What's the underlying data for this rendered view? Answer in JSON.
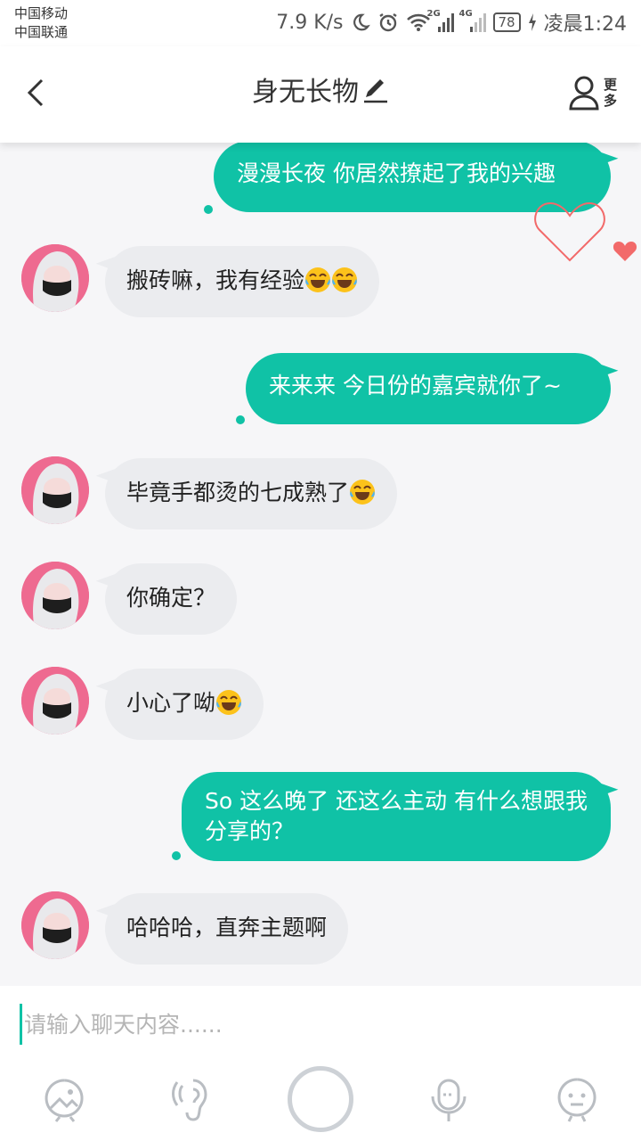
{
  "status_bar": {
    "carrier_1": "中国移动",
    "carrier_2": "中国联通",
    "net_speed": "7.9 K/s",
    "sig1_label": "2G",
    "sig2_label": "4G",
    "battery": "78",
    "time": "凌晨1:24"
  },
  "header": {
    "title": "身无长物",
    "more_label": "更多"
  },
  "messages": [
    {
      "side": "right",
      "text": "漫漫长夜 你居然撩起了我的兴趣"
    },
    {
      "side": "left",
      "text": "搬砖嘛，我有经验",
      "emoji": "tears-of-joy x2"
    },
    {
      "side": "right",
      "text": "来来来 今日份的嘉宾就你了~"
    },
    {
      "side": "left",
      "text": "毕竟手都烫的七成熟了",
      "emoji": "tears-of-joy"
    },
    {
      "side": "left",
      "text": "你确定？"
    },
    {
      "side": "left",
      "text": "小心了呦",
      "emoji": "tears-of-joy"
    },
    {
      "side": "right",
      "text": "So 这么晚了 还这么主动 有什么想跟我分享的？"
    },
    {
      "side": "left",
      "text": "哈哈哈，直奔主题啊"
    }
  ],
  "input": {
    "placeholder": "请输入聊天内容......"
  },
  "toolbar": {
    "icons": [
      "image-icon",
      "voice-effect-icon",
      "record-button",
      "voice-to-text-icon",
      "emoji-icon"
    ]
  },
  "colors": {
    "accent": "#10c2a6",
    "bubble_left": "#ebecef",
    "avatar_bg": "#ee6a90",
    "heart": "#f26a6a"
  }
}
